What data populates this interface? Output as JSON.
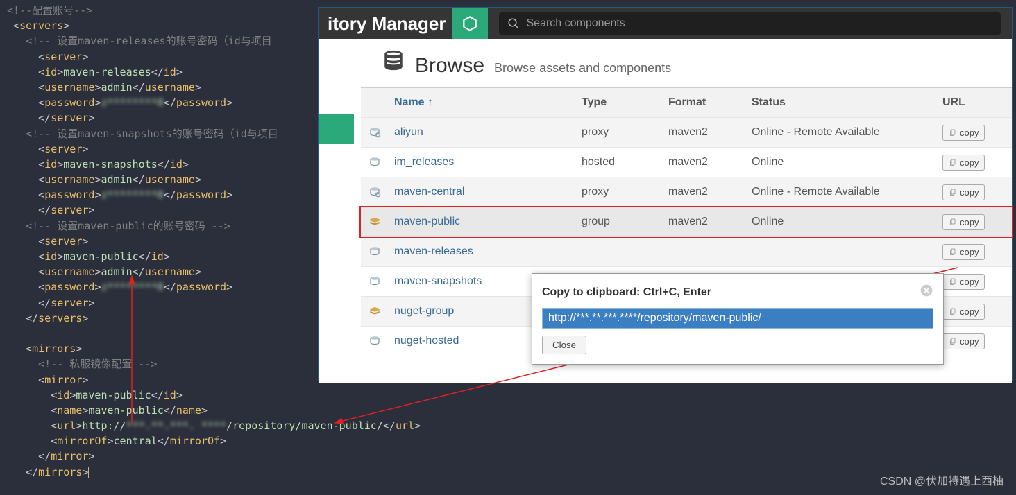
{
  "code": {
    "comment_top": "<!--配置账号-->",
    "servers_open": "servers",
    "c1": "<!-- 设置maven-releases的账号密码（id与项目",
    "c2": "<!-- 设置maven-snapshots的账号密码（id与项目",
    "c3": "<!-- 设置maven-public的账号密码 -->",
    "server_tag": "server",
    "id_tag": "id",
    "username_tag": "username",
    "password_tag": "password",
    "id1": "maven-releases",
    "id2": "maven-snapshots",
    "id3": "maven-public",
    "user": "admin",
    "pwd_blur": "z********0",
    "mirrors_tag": "mirrors",
    "c4": "<!-- 私服镜像配置 -->",
    "mirror_tag": "mirror",
    "name_tag": "name",
    "url_tag": "url",
    "mirrorof_tag": "mirrorOf",
    "mirror_id": "maven-public",
    "mirror_name": "maven-public",
    "url_pre": "http://",
    "url_mid_blur": "***.**.***. ****",
    "url_suf": "/repository/maven-public/",
    "mirrorof_val": "central"
  },
  "nm": {
    "title": "itory Manager",
    "search_placeholder": "Search components",
    "browse_title": "Browse",
    "browse_sub": "Browse assets and components",
    "cols": {
      "name": "Name",
      "type": "Type",
      "format": "Format",
      "status": "Status",
      "url": "URL"
    },
    "rows": [
      {
        "icon": "proxy",
        "name": "aliyun",
        "type": "proxy",
        "format": "maven2",
        "status": "Online - Remote Available"
      },
      {
        "icon": "hosted",
        "name": "im_releases",
        "type": "hosted",
        "format": "maven2",
        "status": "Online"
      },
      {
        "icon": "proxy",
        "name": "maven-central",
        "type": "proxy",
        "format": "maven2",
        "status": "Online - Remote Available"
      },
      {
        "icon": "group",
        "name": "maven-public",
        "type": "group",
        "format": "maven2",
        "status": "Online"
      },
      {
        "icon": "hosted",
        "name": "maven-releases",
        "type": "",
        "format": "",
        "status": ""
      },
      {
        "icon": "hosted",
        "name": "maven-snapshots",
        "type": "",
        "format": "",
        "status": ""
      },
      {
        "icon": "group",
        "name": "nuget-group",
        "type": "",
        "format": "",
        "status": ""
      },
      {
        "icon": "hosted",
        "name": "nuget-hosted",
        "type": "",
        "format": "",
        "status": ""
      }
    ],
    "copy_label": "copy"
  },
  "popup": {
    "title": "Copy to clipboard: Ctrl+C, Enter",
    "value": "http://***.**.***.****/repository/maven-public/",
    "close": "Close"
  },
  "watermark": "CSDN @伏加特遇上西柚"
}
